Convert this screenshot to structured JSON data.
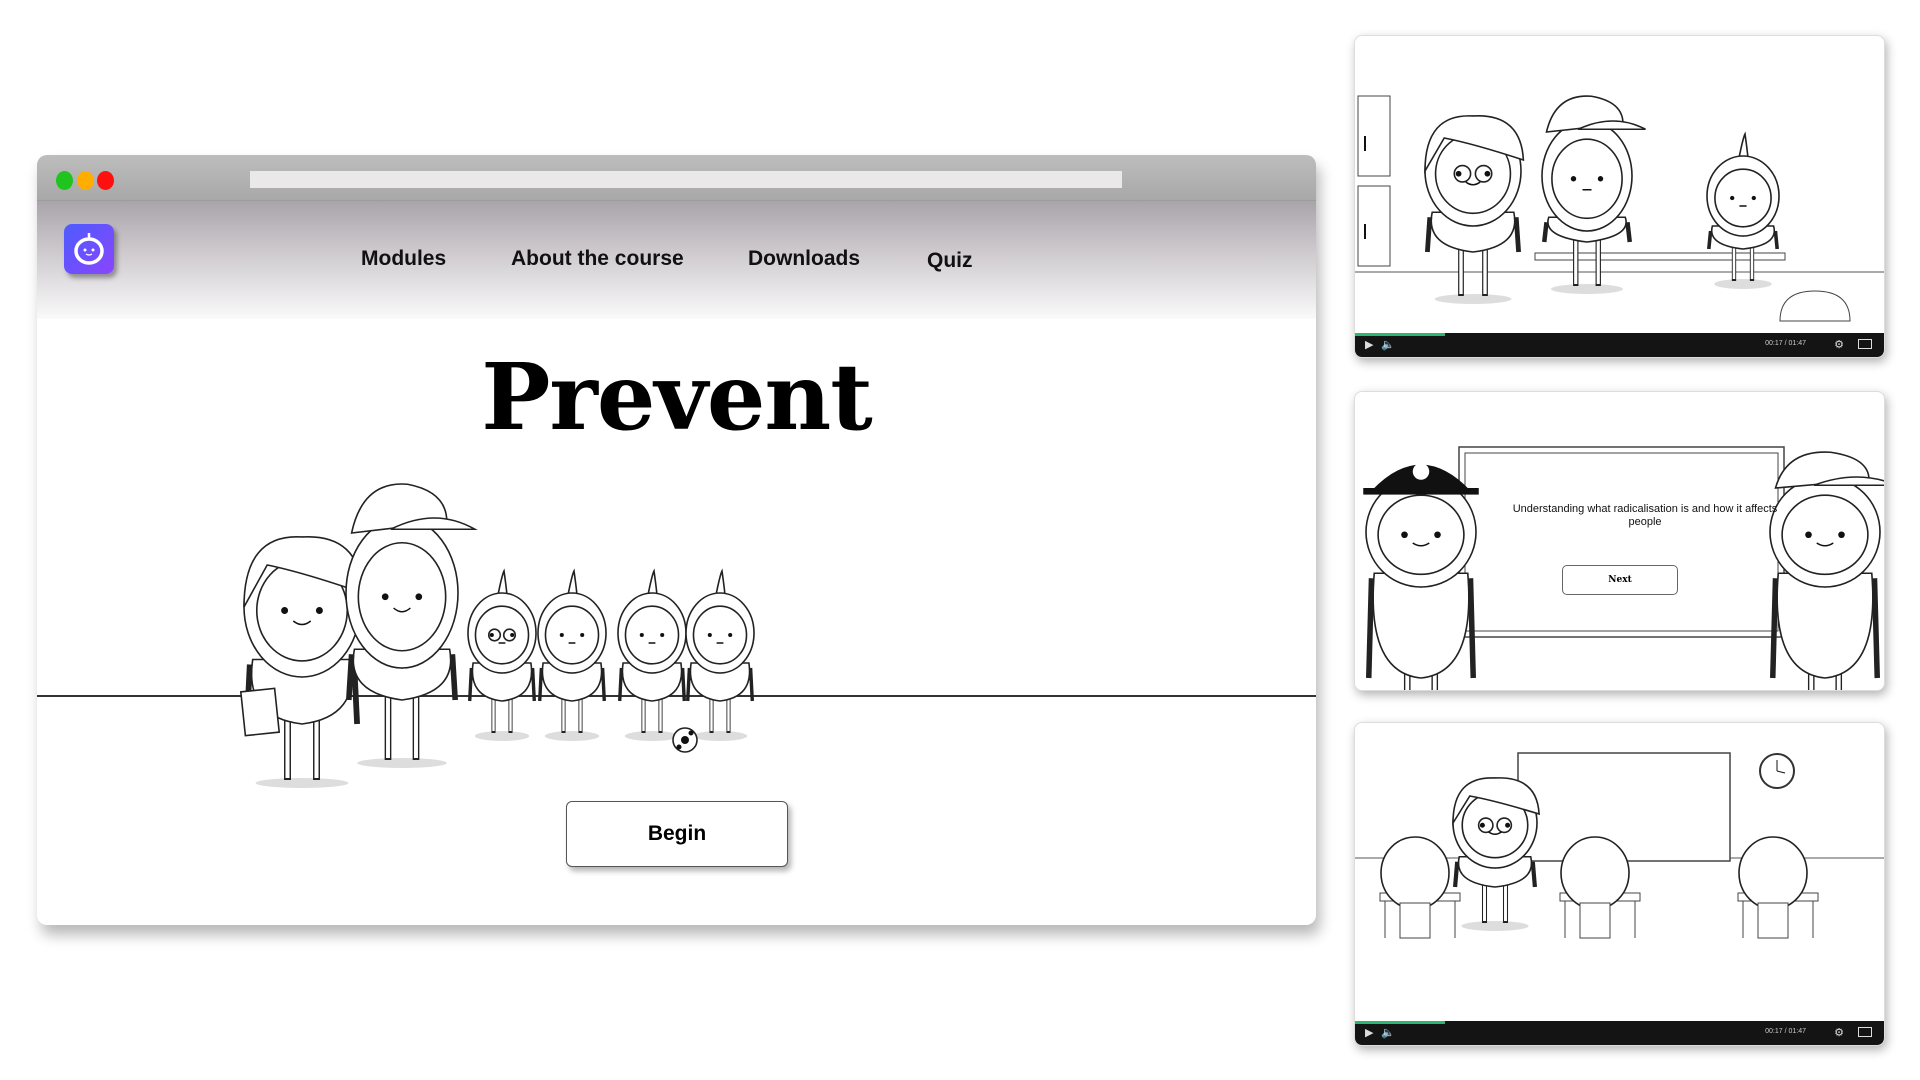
{
  "browser": {
    "window_controls": [
      {
        "name": "green",
        "color": "#1fc41f"
      },
      {
        "name": "yellow",
        "color": "#ffae00"
      },
      {
        "name": "red",
        "color": "#ff1010"
      }
    ],
    "address_bar": ""
  },
  "header": {
    "logo_icon": "robot-face-icon",
    "logo_color": "#5a4dff",
    "nav": [
      {
        "label": "Modules"
      },
      {
        "label": "About the course"
      },
      {
        "label": "Downloads"
      },
      {
        "label": "Quiz"
      }
    ]
  },
  "hero": {
    "title": "Prevent",
    "begin_label": "Begin"
  },
  "videos": [
    {
      "scene": "locker room with teacher, coach and pupil on bench",
      "time": "00:17 / 01:47",
      "progress_percent": 17
    },
    {
      "scene": "police officer and coach beside blackboard",
      "board_text": "Understanding what radicalisation is and how it affects people",
      "next_label": "Next"
    },
    {
      "scene": "classroom with teacher, blackboard, clock and pupils at desks",
      "time": "00:17 / 01:47",
      "progress_percent": 17
    }
  ],
  "player_icons": [
    "play-icon",
    "volume-icon",
    "settings-icon",
    "fullscreen-icon"
  ],
  "accent_progress_color": "#2bb673"
}
